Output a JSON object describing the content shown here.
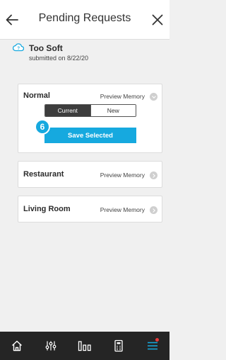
{
  "header": {
    "title": "Pending Requests",
    "back_icon": "arrow-left-icon",
    "close_icon": "close-icon"
  },
  "request": {
    "icon": "cloud-alert-icon",
    "title": "Too Soft",
    "subtitle": "submitted on 8/22/20"
  },
  "memories": [
    {
      "name": "Normal",
      "preview_label": "Preview Memory",
      "expanded": true,
      "toggle": {
        "options": [
          "Current",
          "New"
        ],
        "selected": "Current"
      },
      "save_label": "Save Selected",
      "step_badge": "6"
    },
    {
      "name": "Restaurant",
      "preview_label": "Preview Memory",
      "expanded": false
    },
    {
      "name": "Living Room",
      "preview_label": "Preview Memory",
      "expanded": false
    }
  ],
  "tabbar": {
    "items": [
      {
        "icon": "home-icon"
      },
      {
        "icon": "sliders-icon"
      },
      {
        "icon": "bars-icon"
      },
      {
        "icon": "remote-icon"
      },
      {
        "icon": "menu-icon",
        "notification": true
      }
    ]
  },
  "colors": {
    "accent": "#16a9df",
    "tabbar_bg": "#252525",
    "page_bg": "#f0f0f0",
    "notification": "#e83a3a"
  }
}
